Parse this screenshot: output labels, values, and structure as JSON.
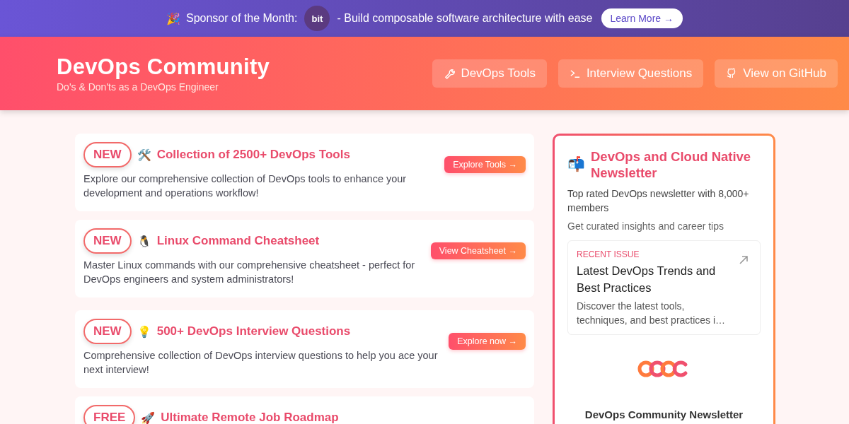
{
  "sponsor_bar": {
    "emoji": "🎉",
    "label": "Sponsor of the Month:",
    "logo": "bit",
    "text": "- Build composable software architecture with ease",
    "button": "Learn More →"
  },
  "header": {
    "title": "DevOps Community",
    "subtitle": "Do's & Don'ts as a DevOps Engineer",
    "nav": [
      {
        "kind": "wrench",
        "label": "DevOps Tools"
      },
      {
        "kind": "terminal",
        "label": "Interview Questions"
      },
      {
        "kind": "github",
        "label": "View on GitHub"
      }
    ]
  },
  "cards": [
    {
      "badge": "NEW",
      "emoji": "🛠️",
      "title": "Collection of 2500+ DevOps Tools",
      "description": "Explore our comprehensive collection of DevOps tools to enhance your development and operations workflow!",
      "button": "Explore Tools →"
    },
    {
      "badge": "NEW",
      "emoji": "🐧",
      "title": "Linux Command Cheatsheet",
      "description": "Master Linux commands with our comprehensive cheatsheet - perfect for DevOps engineers and system administrators!",
      "button": "View Cheatsheet →"
    },
    {
      "badge": "NEW",
      "emoji": "💡",
      "title": "500+ DevOps Interview Questions",
      "description": "Comprehensive collection of DevOps interview questions to help you ace your next interview!",
      "button": "Explore now →"
    },
    {
      "badge": "FREE",
      "emoji": "🚀",
      "title": "Ultimate Remote Job Roadmap"
    }
  ],
  "newsletter": {
    "emoji": "📬",
    "title": "DevOps and Cloud Native Newsletter",
    "description": "Top rated DevOps newsletter with 8,000+ members",
    "tagline": "Get curated insights and career tips",
    "recent_issue": {
      "label": "RECENT ISSUE",
      "title": "Latest DevOps Trends and Best Practices",
      "excerpt": "Discover the latest tools, techniques, and best practices i…"
    },
    "footer_title": "DevOps Community Newsletter"
  }
}
